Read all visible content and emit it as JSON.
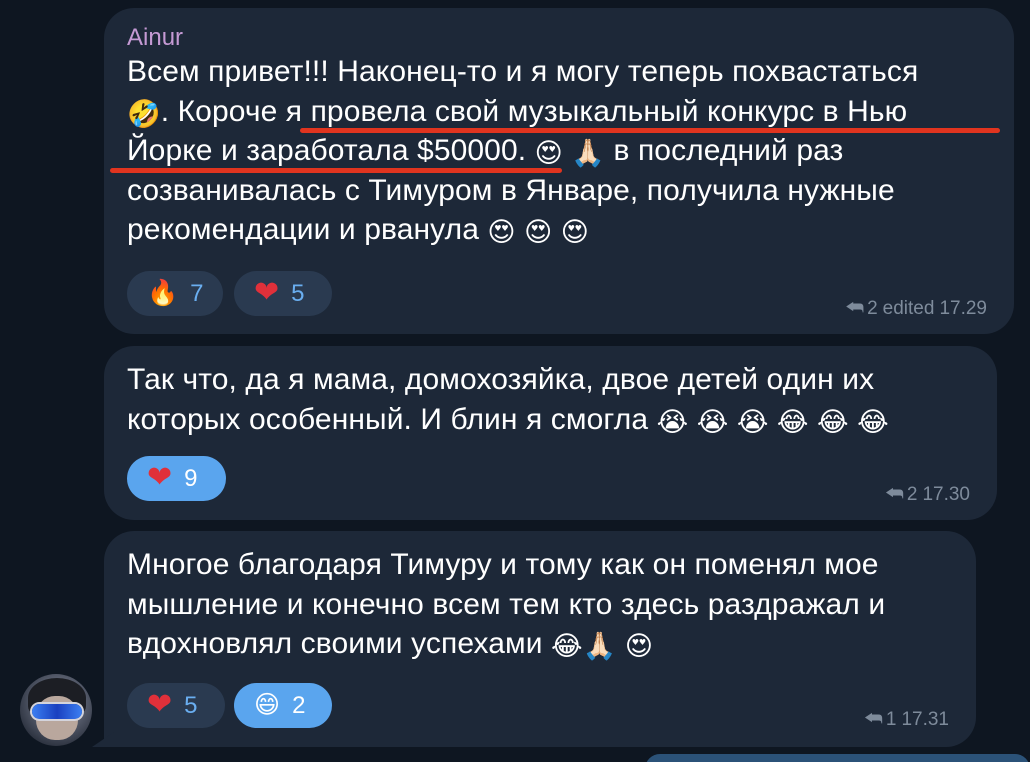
{
  "messages": [
    {
      "sender": "Ainur",
      "text_parts": [
        "Всем привет!!! Наконец-то и я могу теперь похвастаться\n",
        ". Короче я провела свой музыкальный конкурс в Нью\nЙорке и заработала $50000. ",
        " в последний раз\nсозванивалась с Тимуром в Январе, получила нужные\nрекомендации и рванула "
      ],
      "emojis": [
        "🤣",
        "😍",
        "🙏🏻",
        "😍",
        "😍",
        "😍"
      ],
      "reactions": [
        {
          "emoji": "🔥",
          "count": "7"
        },
        {
          "emoji": "❤",
          "count": "5"
        }
      ],
      "meta": {
        "replies": "2",
        "status": "edited",
        "time": "17.29"
      }
    },
    {
      "text": "Так что, да я мама, домохозяйка, двое детей один их\nкоторых особенный. И блин я смогла ",
      "emojis": [
        "😭",
        "😭",
        "😭",
        "😂",
        "😂",
        "😂"
      ],
      "reactions": [
        {
          "emoji": "❤",
          "count": "9"
        }
      ],
      "meta": {
        "replies": "2",
        "time": "17.30"
      }
    },
    {
      "text": "Многое благодаря Тимуру и тому как он поменял мое\nмышление и конечно всем тем кто здесь раздражал и\nвдохновлял своими успехами ",
      "emojis": [
        "😂",
        "🙏🏻",
        "😍"
      ],
      "reactions": [
        {
          "emoji": "❤",
          "count": "5"
        },
        {
          "emoji": "😄",
          "count": "2"
        }
      ],
      "meta": {
        "replies": "1",
        "time": "17.31"
      }
    }
  ],
  "icons": {
    "reply": "reply-arrow-icon",
    "avatar": "user-avatar"
  },
  "colors": {
    "background": "#0e1621",
    "bubble": "#1d2838",
    "sender_name": "#c59ad4",
    "reaction_bg": "#2a3a50",
    "reaction_active_bg": "#5aa5ee",
    "reaction_count": "#6aaef0",
    "underline_annotation": "#e0341f",
    "meta_text": "#7e8b9b"
  }
}
